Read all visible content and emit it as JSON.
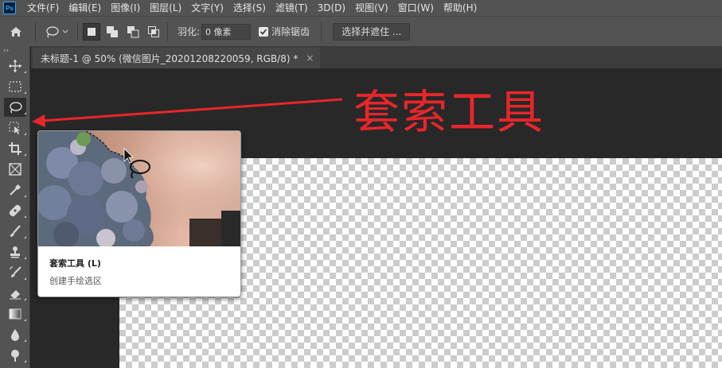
{
  "app": {
    "logo_text": "Ps"
  },
  "menu": [
    "文件(F)",
    "编辑(E)",
    "图像(I)",
    "图层(L)",
    "文字(Y)",
    "选择(S)",
    "滤镜(T)",
    "3D(D)",
    "视图(V)",
    "窗口(W)",
    "帮助(H)"
  ],
  "options": {
    "feather_label": "羽化:",
    "feather_value": "0 像素",
    "antialias_label": "消除锯齿",
    "antialias_checked": true,
    "select_mask_label": "选择并遮住 ..."
  },
  "toolbar": {
    "collapse": "››",
    "tools": [
      {
        "name": "move-tool",
        "icon": "move-icon"
      },
      {
        "name": "marquee-tool",
        "icon": "marquee-icon"
      },
      {
        "name": "lasso-tool",
        "icon": "lasso-icon",
        "selected": true
      },
      {
        "name": "object-select-tool",
        "icon": "object-select-icon"
      },
      {
        "name": "crop-tool",
        "icon": "crop-icon"
      },
      {
        "name": "frame-tool",
        "icon": "frame-icon"
      },
      {
        "name": "eyedropper-tool",
        "icon": "eyedropper-icon"
      },
      {
        "name": "healing-brush-tool",
        "icon": "bandage-icon"
      },
      {
        "name": "brush-tool",
        "icon": "brush-icon"
      },
      {
        "name": "clone-stamp-tool",
        "icon": "stamp-icon"
      },
      {
        "name": "history-brush-tool",
        "icon": "history-brush-icon"
      },
      {
        "name": "eraser-tool",
        "icon": "eraser-icon"
      },
      {
        "name": "gradient-tool",
        "icon": "gradient-icon"
      },
      {
        "name": "blur-tool",
        "icon": "drop-icon"
      },
      {
        "name": "dodge-tool",
        "icon": "dodge-icon"
      }
    ]
  },
  "document": {
    "tab_title": "未标题-1 @ 50% (微信图片_20201208220059, RGB/8) *",
    "close": "×"
  },
  "annotation": {
    "text": "套索工具",
    "color": "#e8262a"
  },
  "tooltip": {
    "title": "套索工具 (L)",
    "description": "创建手绘选区"
  }
}
